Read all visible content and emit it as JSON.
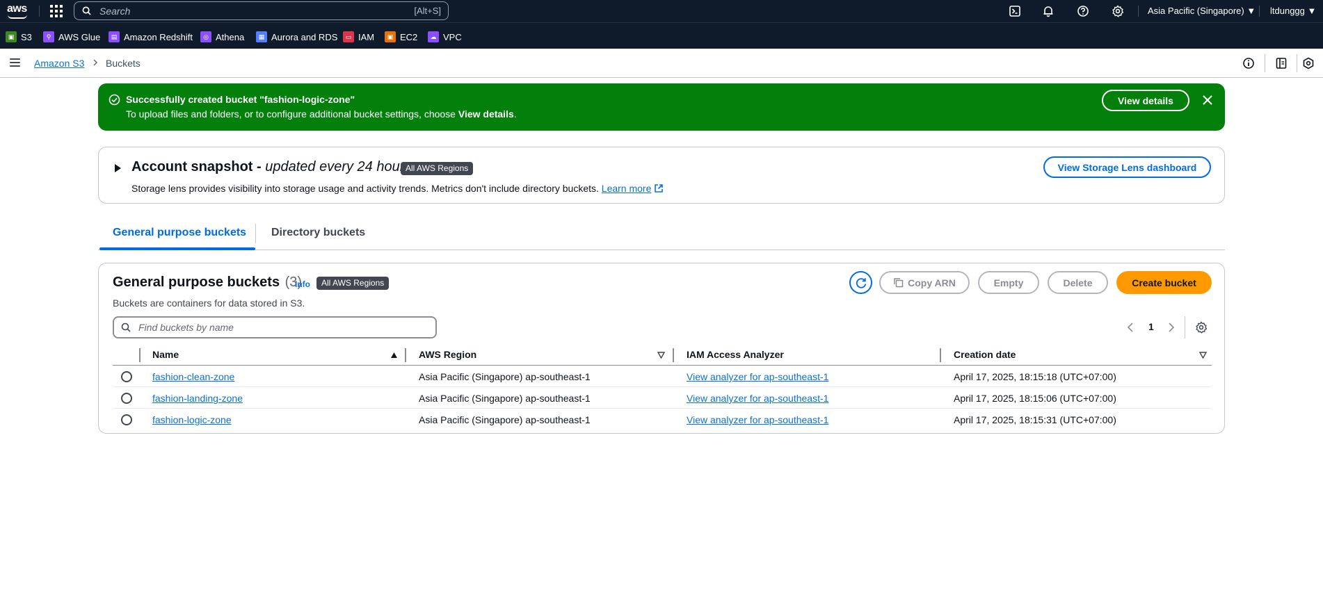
{
  "topnav": {
    "logo": "aws",
    "search_placeholder": "Search",
    "search_shortcut": "[Alt+S]",
    "region": "Asia Pacific (Singapore) ▼",
    "user": "ltdunggg ▼",
    "icons": [
      "cloudshell-icon",
      "bell-icon",
      "help-icon",
      "gear-icon"
    ]
  },
  "favorites": [
    {
      "label": "S3",
      "icon": "s3-icon",
      "color": "#3f8624"
    },
    {
      "label": "AWS Glue",
      "icon": "glue-icon",
      "color": "#8c4fff"
    },
    {
      "label": "Amazon Redshift",
      "icon": "redshift-icon",
      "color": "#8c4fff"
    },
    {
      "label": "Athena",
      "icon": "athena-icon",
      "color": "#8c4fff"
    },
    {
      "label": "Aurora and RDS",
      "icon": "rds-icon",
      "color": "#527fff"
    },
    {
      "label": "IAM",
      "icon": "iam-icon",
      "color": "#dd344c"
    },
    {
      "label": "EC2",
      "icon": "ec2-icon",
      "color": "#ed7100"
    },
    {
      "label": "VPC",
      "icon": "vpc-icon",
      "color": "#8c4fff"
    }
  ],
  "breadcrumb": {
    "root": "Amazon S3",
    "current": "Buckets"
  },
  "flash": {
    "title": "Successfully created bucket \"fashion-logic-zone\"",
    "message_prefix": "To upload files and folders, or to configure additional bucket settings, choose ",
    "message_bold": "View details",
    "message_suffix": ".",
    "button": "View details",
    "color": "#037f0c"
  },
  "snapshot": {
    "title": "Account snapshot - ",
    "title_italic": "updated every 24 hours",
    "badge": "All AWS Regions",
    "description": "Storage lens provides visibility into storage usage and activity trends. Metrics don't include directory buckets. ",
    "learn_more": "Learn more",
    "button": "View Storage Lens dashboard"
  },
  "tabs": [
    {
      "label": "General purpose buckets",
      "active": true
    },
    {
      "label": "Directory buckets",
      "active": false
    }
  ],
  "buckets": {
    "title": "General purpose buckets",
    "count": "(3)",
    "info": "Info",
    "badge": "All AWS Regions",
    "subtitle": "Buckets are containers for data stored in S3.",
    "actions": {
      "copy_arn": "Copy ARN",
      "empty": "Empty",
      "delete": "Delete",
      "create": "Create bucket"
    },
    "filter_placeholder": "Find buckets by name",
    "page": "1",
    "columns": [
      "Name",
      "AWS Region",
      "IAM Access Analyzer",
      "Creation date"
    ],
    "rows": [
      {
        "name": "fashion-clean-zone",
        "region": "Asia Pacific (Singapore) ap-southeast-1",
        "analyzer": "View analyzer for ap-southeast-1",
        "created": "April 17, 2025, 18:15:18 (UTC+07:00)"
      },
      {
        "name": "fashion-landing-zone",
        "region": "Asia Pacific (Singapore) ap-southeast-1",
        "analyzer": "View analyzer for ap-southeast-1",
        "created": "April 17, 2025, 18:15:06 (UTC+07:00)"
      },
      {
        "name": "fashion-logic-zone",
        "region": "Asia Pacific (Singapore) ap-southeast-1",
        "analyzer": "View analyzer for ap-southeast-1",
        "created": "April 17, 2025, 18:15:31 (UTC+07:00)"
      }
    ]
  },
  "colors": {
    "nav_bg": "#0f1b2a",
    "link": "#0972d3",
    "primary": "#ff9900",
    "active_tab": "#006ce0"
  }
}
